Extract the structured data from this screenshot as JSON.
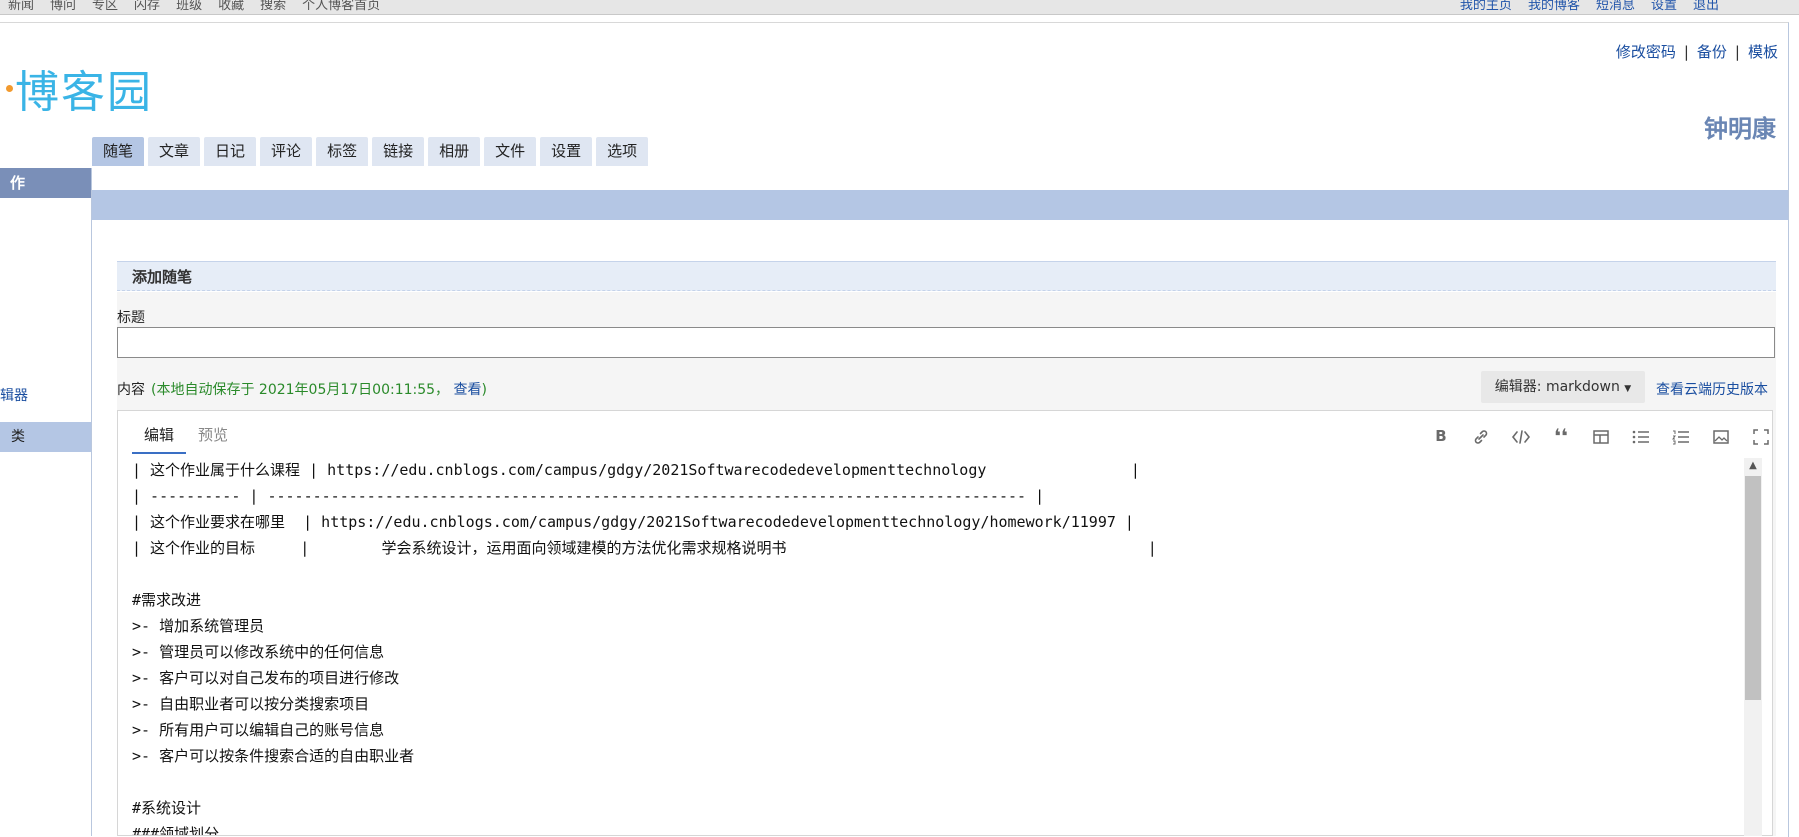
{
  "topbar": {
    "left": [
      "新闻",
      "博问",
      "专区",
      "闪存",
      "班级",
      "收藏",
      "搜索",
      "个人博客首页"
    ],
    "right": [
      "我的主页",
      "我的博客",
      "短消息",
      "设置",
      "退出"
    ]
  },
  "header": {
    "links": [
      "修改密码",
      "备份",
      "模板"
    ],
    "logo_text": "博客园",
    "username": "钟明康"
  },
  "tabs": [
    "随笔",
    "文章",
    "日记",
    "评论",
    "标签",
    "链接",
    "相册",
    "文件",
    "设置",
    "选项"
  ],
  "active_tab": "随笔",
  "sidebar": {
    "head": "作",
    "link": "辑器",
    "active": "类"
  },
  "form": {
    "section_title": "添加随笔",
    "title_label": "标题",
    "title_value": "",
    "content_label": "内容",
    "autosave_prefix": "(本地自动保存于 2021年05月17日00:11:55，",
    "autosave_view": "查看",
    "autosave_suffix": ")",
    "editor_select": "编辑器: markdown",
    "cloud_history": "查看云端历史版本"
  },
  "editor": {
    "tabs": [
      "编辑",
      "预览"
    ],
    "tools": [
      "bold-icon",
      "link-icon",
      "code-icon",
      "quote-icon",
      "table-icon",
      "bullet-list-icon",
      "numbered-list-icon",
      "image-icon",
      "fullscreen-icon"
    ],
    "lines": [
      "| 这个作业属于什么课程 | https://edu.cnblogs.com/campus/gdgy/2021Softwarecodedevelopmenttechnology                |",
      "| ---------- | ------------------------------------------------------------------------------------ |",
      "| 这个作业要求在哪里  | https://edu.cnblogs.com/campus/gdgy/2021Softwarecodedevelopmenttechnology/homework/11997 |",
      "| 这个作业的目标     |        学会系统设计，运用面向领域建模的方法优化需求规格说明书                                        |",
      "",
      "#需求改进",
      ">- 增加系统管理员",
      ">- 管理员可以修改系统中的任何信息",
      ">- 客户可以对自己发布的项目进行修改",
      ">- 自由职业者可以按分类搜索项目",
      ">- 所有用户可以编辑自己的账号信息",
      ">- 客户可以按条件搜索合适的自由职业者",
      "",
      "#系统设计",
      "###领域划分"
    ]
  }
}
